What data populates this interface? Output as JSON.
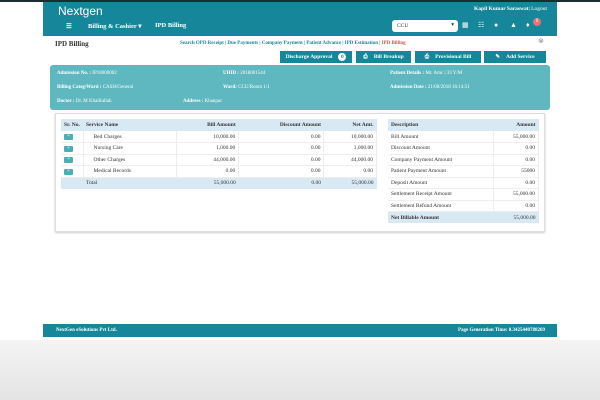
{
  "header": {
    "logo": "Nextgen",
    "user": "Kapil Kumar Saraswat",
    "logout": "| Logout",
    "menu": "Billing & Cashier ▾",
    "crumb": "IPD Billing",
    "select": "CCU",
    "notif_count": "0"
  },
  "page": {
    "title": "IPD Billing",
    "links": [
      "Search OPD Receipt",
      "Due Payments",
      "Company Payment",
      "Patient Advance",
      "IPD Estimation"
    ],
    "active_link": "IPD Billing"
  },
  "buttons": {
    "discharge": "Discharge Approval",
    "discharge_count": "0",
    "breakup": "Bill Breakup",
    "provisional": "Provisional Bill",
    "add": "Add Service"
  },
  "info": {
    "adm_label": "Admission No. :",
    "adm": "IP18000002",
    "uhid_label": "UHID :",
    "uhid": "2018001544",
    "pd_label": "Patient Details :",
    "pd": "Mr. Amc | 33 Y/M",
    "cat_label": "Billing Categ/Ward :",
    "cat": "CASH/General",
    "ward_label": "Ward:",
    "ward": "CCU/Room 1/1",
    "ad_label": "Admission Date :",
    "ad": "21/08/2018 16:14:51",
    "doc_label": "Doctor :",
    "doc": "Dr. M Khalilullah",
    "addr_label": "Address :",
    "addr": "Khanpur"
  },
  "services": {
    "headers": [
      "Sr. No.",
      "Service Name",
      "Bill Amount",
      "Discount Amount",
      "Net Amt."
    ],
    "rows": [
      {
        "name": "Bed Charges",
        "bill": "10,000.00",
        "disc": "0.00",
        "net": "10,000.00"
      },
      {
        "name": "Nursing Care",
        "bill": "1,000.00",
        "disc": "0.00",
        "net": "1,000.00"
      },
      {
        "name": "Other Charges",
        "bill": "44,000.00",
        "disc": "0.00",
        "net": "44,000.00"
      },
      {
        "name": "Medical Records",
        "bill": "0.00",
        "disc": "0.00",
        "net": "0.00"
      }
    ],
    "total": {
      "label": "Total",
      "bill": "55,000.00",
      "disc": "0.00",
      "net": "55,000.00"
    }
  },
  "summary": {
    "headers": [
      "Description",
      "Amount"
    ],
    "rows": [
      {
        "d": "Bill Amount",
        "a": "55,000.00"
      },
      {
        "d": "Discount Amount",
        "a": "0.00"
      },
      {
        "d": "Company Payment Amount",
        "a": "0.00"
      },
      {
        "d": "Patient Payment Amount",
        "a": "55000"
      },
      {
        "d": "Deposit Amount",
        "a": "0.00"
      },
      {
        "d": "Settlement Receipt Amount",
        "a": "55,000.00"
      },
      {
        "d": "Settlement Refund Amount",
        "a": "0.00"
      }
    ],
    "total": {
      "d": "Net Billable Amount",
      "a": "55,000.00"
    }
  },
  "footer": {
    "company": "NextGen eSolutions Pvt Ltd.",
    "gen": "Page Generation Time: 0.3425440788269"
  }
}
